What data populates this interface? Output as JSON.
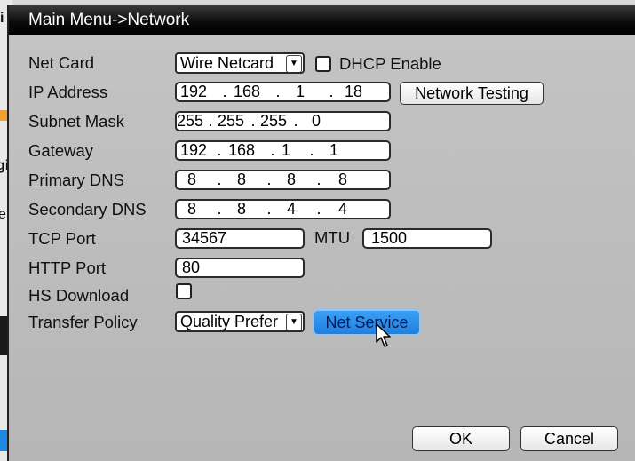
{
  "window": {
    "title": "Main Menu->Network"
  },
  "background_fragments": {
    "frag1": "i",
    "frag2": "gi",
    "frag3": "e"
  },
  "form": {
    "net_card": {
      "label": "Net Card",
      "value": "Wire Netcard"
    },
    "dhcp": {
      "label": "DHCP Enable",
      "checked": false
    },
    "ip_address": {
      "label": "IP Address",
      "octets": [
        "192",
        "168",
        "1",
        "18"
      ]
    },
    "network_testing": {
      "label": "Network Testing"
    },
    "subnet_mask": {
      "label": "Subnet Mask",
      "octets": [
        "255",
        "255",
        "255",
        "0"
      ]
    },
    "gateway": {
      "label": "Gateway",
      "octets": [
        "192",
        "168",
        "1",
        "1"
      ]
    },
    "primary_dns": {
      "label": "Primary DNS",
      "octets": [
        "8",
        "8",
        "8",
        "8"
      ]
    },
    "secondary_dns": {
      "label": "Secondary DNS",
      "octets": [
        "8",
        "8",
        "4",
        "4"
      ]
    },
    "tcp_port": {
      "label": "TCP Port",
      "value": "34567"
    },
    "mtu": {
      "label": "MTU",
      "value": "1500"
    },
    "http_port": {
      "label": "HTTP Port",
      "value": "80"
    },
    "hs_download": {
      "label": "HS Download",
      "checked": false
    },
    "transfer_policy": {
      "label": "Transfer Policy",
      "value": "Quality Prefer"
    },
    "net_service": {
      "label": "Net Service"
    }
  },
  "footer": {
    "ok_label": "OK",
    "cancel_label": "Cancel"
  },
  "colors": {
    "accent": "#1f7fe0",
    "titlebar": "#000000",
    "panel": "#bdbdbd"
  }
}
